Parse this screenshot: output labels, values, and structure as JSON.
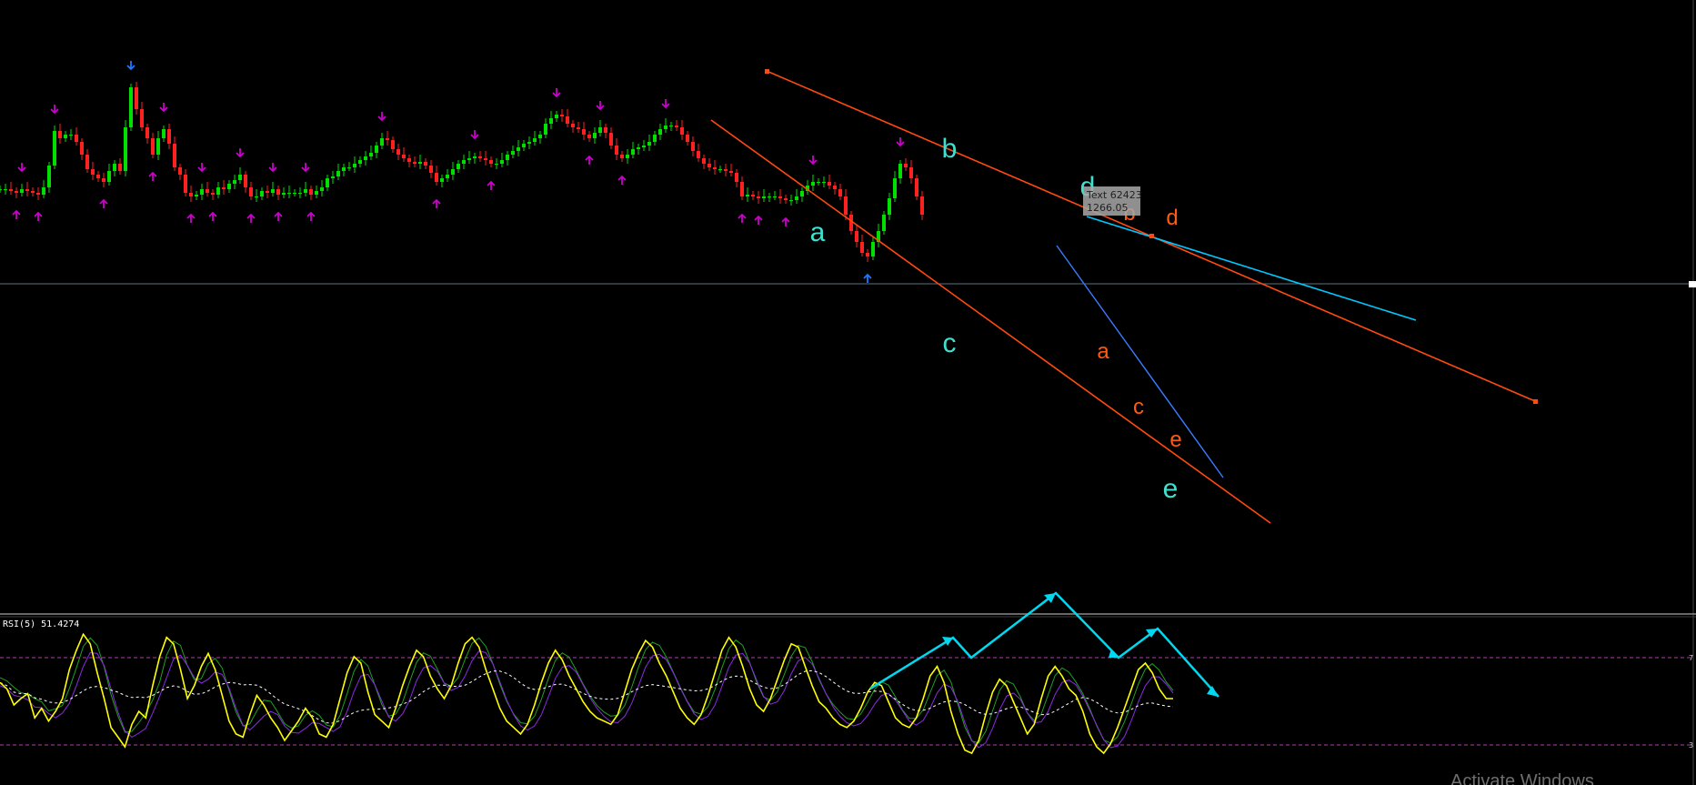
{
  "chart_data": [
    {
      "type": "candlestick",
      "panel": "price",
      "colors": {
        "up": "#00e000",
        "down": "#ff2020",
        "background": "#000000"
      },
      "x": [
        0,
        5,
        10,
        15,
        20,
        25,
        30,
        35,
        40,
        45,
        50,
        55,
        60,
        65,
        70,
        75,
        80,
        85,
        90,
        95,
        100,
        105,
        110,
        115,
        120,
        125,
        130,
        135,
        140,
        145,
        150,
        155,
        160,
        165,
        170,
        175,
        180,
        185,
        190,
        195,
        200,
        205,
        210,
        215,
        220,
        225,
        230,
        235,
        240,
        245,
        250,
        255,
        260,
        265,
        270,
        275,
        280,
        285,
        290,
        295,
        300,
        305,
        310,
        315,
        320,
        325,
        330,
        335,
        340,
        345,
        350,
        355,
        360,
        365,
        370,
        375,
        380,
        385,
        390,
        395,
        400,
        405,
        410,
        415,
        420,
        425,
        430,
        435,
        440,
        445,
        450,
        455,
        460,
        465,
        470,
        475,
        480,
        485,
        490,
        495,
        500,
        505,
        510,
        515,
        520,
        525,
        530,
        535,
        540,
        545,
        550,
        555,
        560,
        565,
        570,
        575,
        580,
        585,
        590,
        595,
        600,
        605,
        610,
        615,
        620,
        625,
        630,
        635,
        640,
        645,
        650,
        655,
        660,
        665,
        670,
        675,
        680,
        685,
        690,
        695,
        700,
        705,
        710,
        715,
        720,
        725,
        730,
        735,
        740,
        745,
        750,
        755,
        760,
        765,
        770,
        775,
        780,
        785,
        790,
        795,
        800,
        805,
        810,
        815,
        820,
        825,
        830,
        835,
        840,
        845,
        850,
        855,
        860,
        865,
        870,
        875,
        880,
        885,
        890,
        895,
        900,
        905,
        910,
        915,
        920,
        925,
        930,
        935,
        940,
        945,
        950,
        955,
        960,
        965,
        970,
        975,
        980,
        985,
        990,
        995,
        1000,
        1005,
        1010,
        1015,
        1020,
        1025,
        1030,
        1035,
        1040,
        1045,
        1050,
        1055,
        1060,
        1065,
        1070,
        1075,
        1080,
        1085,
        1090,
        1095
      ],
      "close": [
        76,
        76,
        75,
        74,
        76,
        75,
        74,
        73,
        77,
        89,
        108,
        104,
        106,
        106,
        102,
        95,
        87,
        84,
        82,
        80,
        86,
        90,
        86,
        110,
        132,
        120,
        110,
        104,
        95,
        104,
        109,
        101,
        88,
        84,
        74,
        72,
        73,
        76,
        74,
        73,
        77,
        76,
        79,
        81,
        84,
        77,
        72,
        72,
        75,
        74,
        76,
        73,
        74,
        74,
        74,
        74,
        76,
        73,
        75,
        77,
        82,
        83,
        86,
        88,
        88,
        90,
        92,
        94,
        96,
        100,
        104,
        103,
        98,
        95,
        93,
        91,
        90,
        91,
        89,
        85,
        80,
        82,
        84,
        87,
        90,
        92,
        93,
        94,
        93,
        92,
        90,
        90,
        92,
        95,
        97,
        99,
        101,
        102,
        104,
        106,
        112,
        115,
        117,
        116,
        112,
        110,
        109,
        106,
        104,
        107,
        110,
        107,
        100,
        95,
        93,
        95,
        98,
        99,
        100,
        102,
        106,
        109,
        111,
        111,
        110,
        106,
        102,
        97,
        93,
        90,
        88,
        87,
        87,
        86,
        85,
        80,
        72,
        73,
        72,
        71,
        72,
        72,
        72,
        71,
        70,
        70,
        72,
        75,
        78,
        80,
        80,
        80,
        78,
        76,
        72,
        62,
        53,
        47,
        41,
        39,
        47,
        53,
        62,
        71,
        82,
        90,
        88,
        82,
        72,
        62
      ],
      "xlim": [
        0,
        1100
      ],
      "ylim": [
        0,
        150
      ],
      "annotations": [
        {
          "kind": "wave-label",
          "text": "a",
          "color": "#40e0d0"
        },
        {
          "kind": "wave-label",
          "text": "b",
          "color": "#40e0d0"
        },
        {
          "kind": "wave-label",
          "text": "c",
          "color": "#40e0d0"
        },
        {
          "kind": "wave-label",
          "text": "d",
          "color": "#40e0d0"
        },
        {
          "kind": "wave-label",
          "text": "e",
          "color": "#40e0d0"
        },
        {
          "kind": "wave-label",
          "text": "a",
          "color": "#ff5a14"
        },
        {
          "kind": "wave-label",
          "text": "b",
          "color": "#ff5a14"
        },
        {
          "kind": "wave-label",
          "text": "c",
          "color": "#ff5a14"
        },
        {
          "kind": "wave-label",
          "text": "d",
          "color": "#ff5a14"
        },
        {
          "kind": "wave-label",
          "text": "e",
          "color": "#ff5a14"
        }
      ],
      "tooltip": {
        "line1": "Text 62423",
        "line2": "1266.05"
      },
      "fractal_colors": {
        "top": "#cc00cc",
        "bottom": "#cc00cc",
        "extreme": "#1e78ff"
      },
      "trendline_colors": {
        "main": "#ff4a10",
        "cyan": "#00c8ff",
        "blue": "#3a7cff"
      }
    },
    {
      "type": "line",
      "panel": "indicator",
      "title": "RSI(5) 51.4274",
      "levels": [
        70,
        30
      ],
      "ylim": [
        0,
        100
      ],
      "series_colors": {
        "rsi": "#ffff00",
        "signal1": "#20a020",
        "signal2": "#8a2be2",
        "average": "#ffffff"
      },
      "rsi": [
        62,
        58,
        48,
        52,
        55,
        40,
        46,
        38,
        44,
        52,
        70,
        82,
        92,
        86,
        68,
        52,
        34,
        28,
        22,
        36,
        44,
        40,
        60,
        78,
        90,
        86,
        70,
        52,
        60,
        72,
        80,
        70,
        54,
        38,
        30,
        28,
        42,
        54,
        48,
        40,
        34,
        26,
        32,
        38,
        46,
        40,
        30,
        28,
        36,
        52,
        68,
        78,
        74,
        56,
        42,
        38,
        34,
        46,
        60,
        72,
        82,
        78,
        66,
        58,
        52,
        60,
        74,
        86,
        90,
        84,
        70,
        58,
        46,
        38,
        34,
        30,
        36,
        48,
        62,
        74,
        82,
        76,
        66,
        58,
        50,
        44,
        40,
        38,
        36,
        42,
        56,
        70,
        80,
        88,
        84,
        74,
        66,
        56,
        46,
        40,
        36,
        42,
        54,
        68,
        82,
        90,
        84,
        72,
        58,
        48,
        44,
        52,
        64,
        76,
        86,
        84,
        72,
        60,
        50,
        46,
        40,
        36,
        34,
        38,
        46,
        56,
        62,
        60,
        50,
        40,
        36,
        34,
        40,
        52,
        66,
        72,
        62,
        44,
        30,
        20,
        18,
        26,
        42,
        56,
        64,
        60,
        50,
        40,
        30,
        36,
        52,
        66,
        72,
        66,
        58,
        54,
        44,
        30,
        22,
        18,
        24,
        34,
        46,
        58,
        70,
        74,
        68,
        58,
        52,
        52
      ]
    }
  ],
  "rsi_arrows": {
    "color": "#00d8f0"
  },
  "footer": {
    "watermark": "Activate Windows"
  }
}
